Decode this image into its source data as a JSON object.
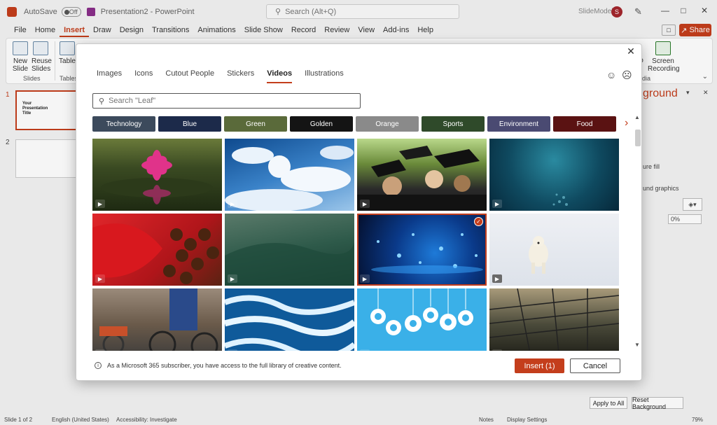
{
  "titlebar": {
    "autosave_label": "AutoSave",
    "autosave_state": "Off",
    "doc_title": "Presentation2 - PowerPoint",
    "search_placeholder": "Search (Alt+Q)",
    "account_name": "SlideModel",
    "avatar_initial": "S"
  },
  "ribbon_tabs": [
    "File",
    "Home",
    "Insert",
    "Draw",
    "Design",
    "Transitions",
    "Animations",
    "Slide Show",
    "Record",
    "Review",
    "View",
    "Add-ins",
    "Help"
  ],
  "active_tab": "Insert",
  "share_label": "Share",
  "ribbon": {
    "new_slide": "New\nSlide",
    "reuse_slides": "Reuse\nSlides",
    "slides_group": "Slides",
    "table": "Table",
    "tables_group": "Tables",
    "screen_recording": "Screen\nRecording",
    "media_group_partial": "dia",
    "media_btn_partial": "io"
  },
  "slides": [
    {
      "number": "1",
      "title": "Your\nPresentation\nTitle"
    },
    {
      "number": "2",
      "title": ""
    }
  ],
  "format_pane": {
    "heading_partial": "ground",
    "picture_fill_partial": "ure fill",
    "background_graphics_partial": "und graphics",
    "transparency_value": "0%",
    "apply_to_all": "Apply to All",
    "reset_background": "Reset Background"
  },
  "statusbar": {
    "slide_count": "Slide 1 of 2",
    "language": "English (United States)",
    "accessibility": "Accessibility: Investigate",
    "notes": "Notes",
    "display_settings": "Display Settings",
    "zoom": "79%"
  },
  "dialog": {
    "tabs": [
      "Images",
      "Icons",
      "Cutout People",
      "Stickers",
      "Videos",
      "Illustrations"
    ],
    "active_tab": "Videos",
    "search_value": "Leaf",
    "search_placeholder": "Search \"Leaf\"",
    "categories": [
      {
        "label": "Technology",
        "color": "#3c4a5c"
      },
      {
        "label": "Blue",
        "color": "#1c2a4a"
      },
      {
        "label": "Green",
        "color": "#5a6a3a"
      },
      {
        "label": "Golden",
        "color": "#141414"
      },
      {
        "label": "Orange",
        "color": "#8a8a8a"
      },
      {
        "label": "Sports",
        "color": "#2f4a2a"
      },
      {
        "label": "Environment",
        "color": "#4a4a72"
      },
      {
        "label": "Food",
        "color": "#5a1212"
      }
    ],
    "footer_text": "As a Microsoft 365 subscriber, you have access to the full library of creative content.",
    "insert_label": "Insert (1)",
    "cancel_label": "Cancel",
    "selected_tile_index": 6
  }
}
